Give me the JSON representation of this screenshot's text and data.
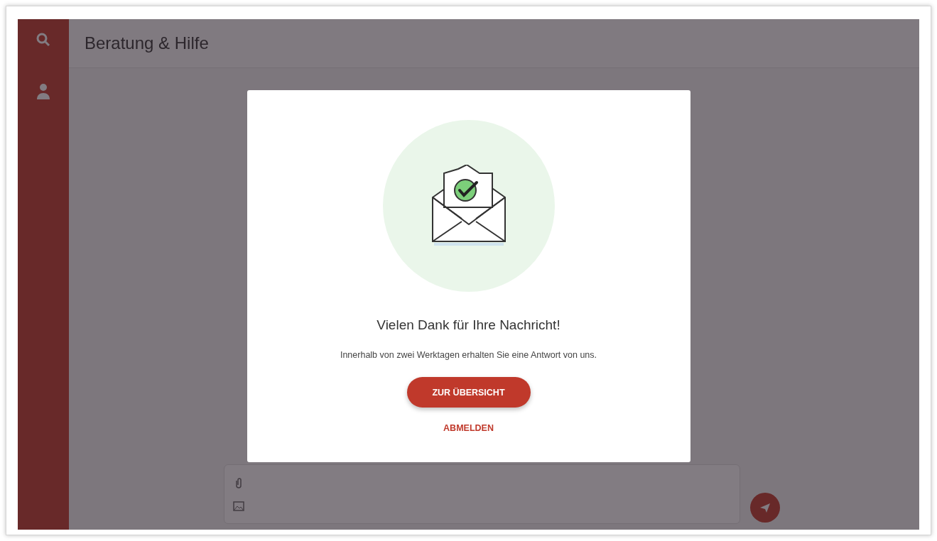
{
  "header": {
    "title": "Beratung & Hilfe"
  },
  "dialog": {
    "title": "Vielen Dank für Ihre Nachricht!",
    "message": "Innerhalb von zwei Werktagen erhalten Sie eine Antwort von uns.",
    "primary_button": "ZUR ÜBERSICHT",
    "secondary_link": "ABMELDEN"
  }
}
